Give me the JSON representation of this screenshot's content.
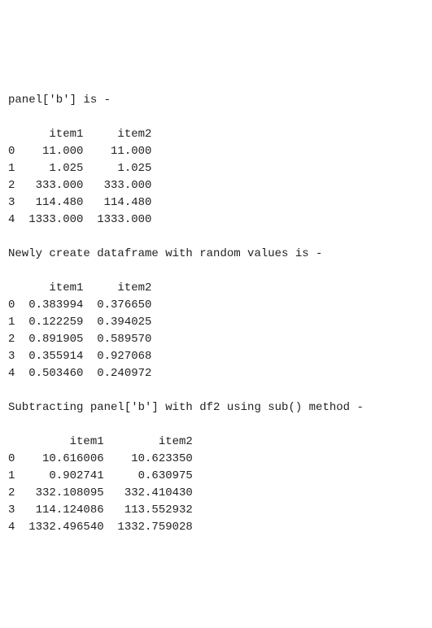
{
  "section1": {
    "title": "panel['b'] is -",
    "columns": [
      "item1",
      "item2"
    ],
    "rows": [
      {
        "idx": "0",
        "item1": "11.000",
        "item2": "11.000"
      },
      {
        "idx": "1",
        "item1": "1.025",
        "item2": "1.025"
      },
      {
        "idx": "2",
        "item1": "333.000",
        "item2": "333.000"
      },
      {
        "idx": "3",
        "item1": "114.480",
        "item2": "114.480"
      },
      {
        "idx": "4",
        "item1": "1333.000",
        "item2": "1333.000"
      }
    ],
    "widths": {
      "idx": 1,
      "col": 10
    }
  },
  "section2": {
    "title": "Newly create dataframe with random values is -",
    "columns": [
      "item1",
      "item2"
    ],
    "rows": [
      {
        "idx": "0",
        "item1": "0.383994",
        "item2": "0.376650"
      },
      {
        "idx": "1",
        "item1": "0.122259",
        "item2": "0.394025"
      },
      {
        "idx": "2",
        "item1": "0.891905",
        "item2": "0.589570"
      },
      {
        "idx": "3",
        "item1": "0.355914",
        "item2": "0.927068"
      },
      {
        "idx": "4",
        "item1": "0.503460",
        "item2": "0.240972"
      }
    ],
    "widths": {
      "idx": 1,
      "col": 10
    }
  },
  "section3": {
    "title": "Subtracting panel['b'] with df2 using sub() method -",
    "columns": [
      "item1",
      "item2"
    ],
    "rows": [
      {
        "idx": "0",
        "item1": "10.616006",
        "item2": "10.623350"
      },
      {
        "idx": "1",
        "item1": "0.902741",
        "item2": "0.630975"
      },
      {
        "idx": "2",
        "item1": "332.108095",
        "item2": "332.410430"
      },
      {
        "idx": "3",
        "item1": "114.124086",
        "item2": "113.552932"
      },
      {
        "idx": "4",
        "item1": "1332.496540",
        "item2": "1332.759028"
      }
    ],
    "widths": {
      "idx": 1,
      "col": 13
    }
  }
}
